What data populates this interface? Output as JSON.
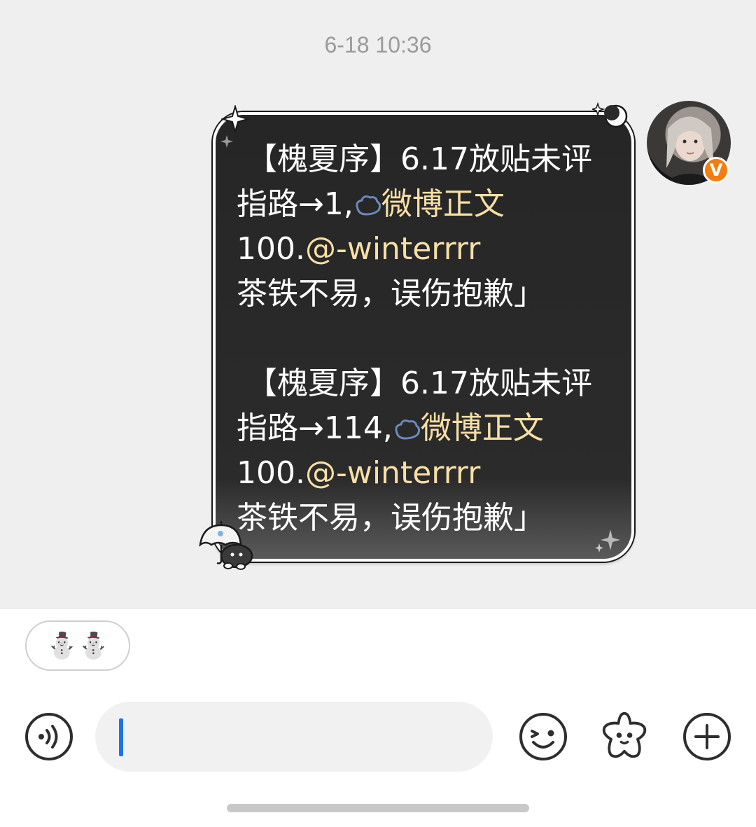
{
  "chat": {
    "timestamp": "6-18 10:36",
    "avatar": {
      "badge_label": "V",
      "badge_color": "#f47d10"
    },
    "message": {
      "block1": {
        "line1": " 【槐夏序】6.17放贴未评",
        "line2_prefix": "指路→1,",
        "line2_link": "微博正文",
        "line3_prefix": "100.",
        "line3_mention": "@-winterrrr",
        "line4": "茶铁不易，误伤抱歉」"
      },
      "block2": {
        "line1": " 【槐夏序】6.17放贴未评",
        "line2_prefix": "指路→114,",
        "line2_link": "微博正文",
        "line3_prefix": "100.",
        "line3_mention": "@-winterrrr",
        "line4": "茶铁不易，误伤抱歉」"
      },
      "highlight_color": "#f7dfa6"
    }
  },
  "quick_reply": {
    "label": "⛄⛄"
  },
  "composer": {
    "input_value": "",
    "icons": [
      "voice-icon",
      "emoji-icon",
      "sticker-icon",
      "add-icon"
    ]
  }
}
